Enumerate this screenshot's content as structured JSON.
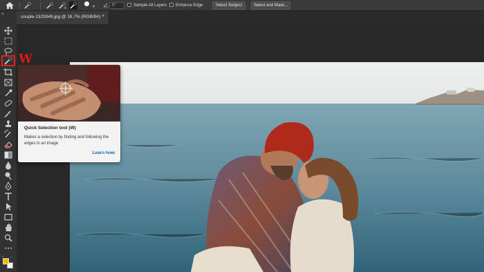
{
  "options_bar": {
    "home_icon": "home-icon",
    "angle_value": "0°",
    "sample_all_layers_label": "Sample All Layers",
    "sample_all_layers_checked": false,
    "enhance_edge_label": "Enhance Edge",
    "enhance_edge_checked": false,
    "select_subject_label": "Select Subject",
    "select_and_mask_label": "Select and Mask..."
  },
  "document_tab": {
    "title": "couple-1329349.jpg @ 16.7% (RGB/8#)",
    "close_glyph": "×"
  },
  "toolbar_grip": "»",
  "annotation": {
    "letter": "W",
    "color": "#e01818"
  },
  "tools": [
    "move-tool-icon",
    "marquee-tool-icon",
    "lasso-tool-icon",
    "quick-selection-tool-icon",
    "crop-tool-icon",
    "frame-tool-icon",
    "eyedropper-tool-icon",
    "healing-brush-icon",
    "brush-tool-icon",
    "clone-stamp-icon",
    "history-brush-icon",
    "eraser-tool-icon",
    "gradient-tool-icon",
    "blur-tool-icon",
    "dodge-tool-icon",
    "pen-tool-icon",
    "type-tool-icon",
    "path-selection-icon",
    "rectangle-tool-icon",
    "hand-tool-icon",
    "zoom-tool-icon",
    "more-tools-icon"
  ],
  "colors": {
    "foreground": "#f5b800",
    "background": "#ffffff"
  },
  "tooltip": {
    "title": "Quick Selection tool (W)",
    "description": "Makes a selection by finding and following the edges in an image",
    "link_label": "Learn how"
  }
}
